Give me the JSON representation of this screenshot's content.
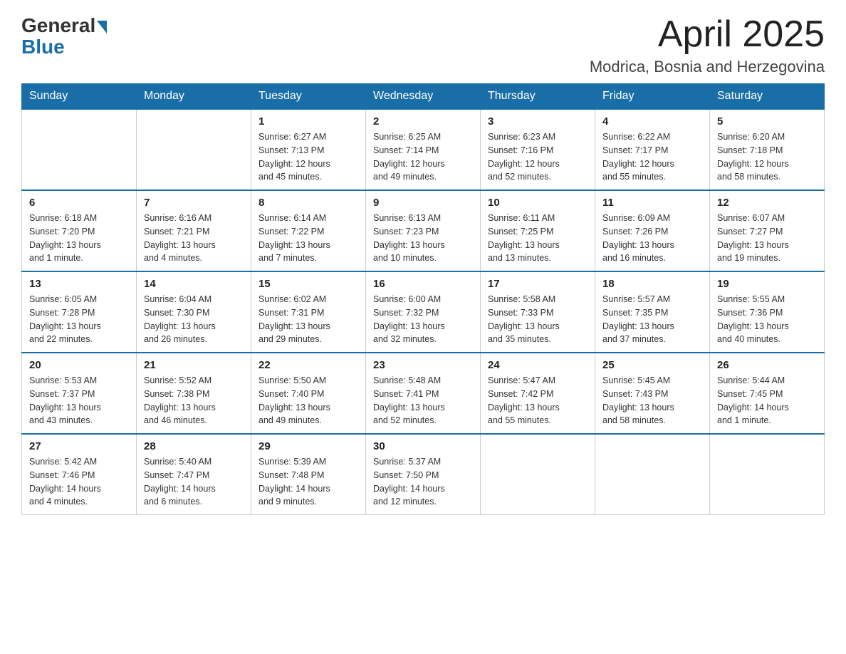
{
  "logo": {
    "general": "General",
    "blue": "Blue"
  },
  "title": "April 2025",
  "subtitle": "Modrica, Bosnia and Herzegovina",
  "headers": [
    "Sunday",
    "Monday",
    "Tuesday",
    "Wednesday",
    "Thursday",
    "Friday",
    "Saturday"
  ],
  "weeks": [
    [
      {
        "day": "",
        "info": ""
      },
      {
        "day": "",
        "info": ""
      },
      {
        "day": "1",
        "info": "Sunrise: 6:27 AM\nSunset: 7:13 PM\nDaylight: 12 hours\nand 45 minutes."
      },
      {
        "day": "2",
        "info": "Sunrise: 6:25 AM\nSunset: 7:14 PM\nDaylight: 12 hours\nand 49 minutes."
      },
      {
        "day": "3",
        "info": "Sunrise: 6:23 AM\nSunset: 7:16 PM\nDaylight: 12 hours\nand 52 minutes."
      },
      {
        "day": "4",
        "info": "Sunrise: 6:22 AM\nSunset: 7:17 PM\nDaylight: 12 hours\nand 55 minutes."
      },
      {
        "day": "5",
        "info": "Sunrise: 6:20 AM\nSunset: 7:18 PM\nDaylight: 12 hours\nand 58 minutes."
      }
    ],
    [
      {
        "day": "6",
        "info": "Sunrise: 6:18 AM\nSunset: 7:20 PM\nDaylight: 13 hours\nand 1 minute."
      },
      {
        "day": "7",
        "info": "Sunrise: 6:16 AM\nSunset: 7:21 PM\nDaylight: 13 hours\nand 4 minutes."
      },
      {
        "day": "8",
        "info": "Sunrise: 6:14 AM\nSunset: 7:22 PM\nDaylight: 13 hours\nand 7 minutes."
      },
      {
        "day": "9",
        "info": "Sunrise: 6:13 AM\nSunset: 7:23 PM\nDaylight: 13 hours\nand 10 minutes."
      },
      {
        "day": "10",
        "info": "Sunrise: 6:11 AM\nSunset: 7:25 PM\nDaylight: 13 hours\nand 13 minutes."
      },
      {
        "day": "11",
        "info": "Sunrise: 6:09 AM\nSunset: 7:26 PM\nDaylight: 13 hours\nand 16 minutes."
      },
      {
        "day": "12",
        "info": "Sunrise: 6:07 AM\nSunset: 7:27 PM\nDaylight: 13 hours\nand 19 minutes."
      }
    ],
    [
      {
        "day": "13",
        "info": "Sunrise: 6:05 AM\nSunset: 7:28 PM\nDaylight: 13 hours\nand 22 minutes."
      },
      {
        "day": "14",
        "info": "Sunrise: 6:04 AM\nSunset: 7:30 PM\nDaylight: 13 hours\nand 26 minutes."
      },
      {
        "day": "15",
        "info": "Sunrise: 6:02 AM\nSunset: 7:31 PM\nDaylight: 13 hours\nand 29 minutes."
      },
      {
        "day": "16",
        "info": "Sunrise: 6:00 AM\nSunset: 7:32 PM\nDaylight: 13 hours\nand 32 minutes."
      },
      {
        "day": "17",
        "info": "Sunrise: 5:58 AM\nSunset: 7:33 PM\nDaylight: 13 hours\nand 35 minutes."
      },
      {
        "day": "18",
        "info": "Sunrise: 5:57 AM\nSunset: 7:35 PM\nDaylight: 13 hours\nand 37 minutes."
      },
      {
        "day": "19",
        "info": "Sunrise: 5:55 AM\nSunset: 7:36 PM\nDaylight: 13 hours\nand 40 minutes."
      }
    ],
    [
      {
        "day": "20",
        "info": "Sunrise: 5:53 AM\nSunset: 7:37 PM\nDaylight: 13 hours\nand 43 minutes."
      },
      {
        "day": "21",
        "info": "Sunrise: 5:52 AM\nSunset: 7:38 PM\nDaylight: 13 hours\nand 46 minutes."
      },
      {
        "day": "22",
        "info": "Sunrise: 5:50 AM\nSunset: 7:40 PM\nDaylight: 13 hours\nand 49 minutes."
      },
      {
        "day": "23",
        "info": "Sunrise: 5:48 AM\nSunset: 7:41 PM\nDaylight: 13 hours\nand 52 minutes."
      },
      {
        "day": "24",
        "info": "Sunrise: 5:47 AM\nSunset: 7:42 PM\nDaylight: 13 hours\nand 55 minutes."
      },
      {
        "day": "25",
        "info": "Sunrise: 5:45 AM\nSunset: 7:43 PM\nDaylight: 13 hours\nand 58 minutes."
      },
      {
        "day": "26",
        "info": "Sunrise: 5:44 AM\nSunset: 7:45 PM\nDaylight: 14 hours\nand 1 minute."
      }
    ],
    [
      {
        "day": "27",
        "info": "Sunrise: 5:42 AM\nSunset: 7:46 PM\nDaylight: 14 hours\nand 4 minutes."
      },
      {
        "day": "28",
        "info": "Sunrise: 5:40 AM\nSunset: 7:47 PM\nDaylight: 14 hours\nand 6 minutes."
      },
      {
        "day": "29",
        "info": "Sunrise: 5:39 AM\nSunset: 7:48 PM\nDaylight: 14 hours\nand 9 minutes."
      },
      {
        "day": "30",
        "info": "Sunrise: 5:37 AM\nSunset: 7:50 PM\nDaylight: 14 hours\nand 12 minutes."
      },
      {
        "day": "",
        "info": ""
      },
      {
        "day": "",
        "info": ""
      },
      {
        "day": "",
        "info": ""
      }
    ]
  ]
}
